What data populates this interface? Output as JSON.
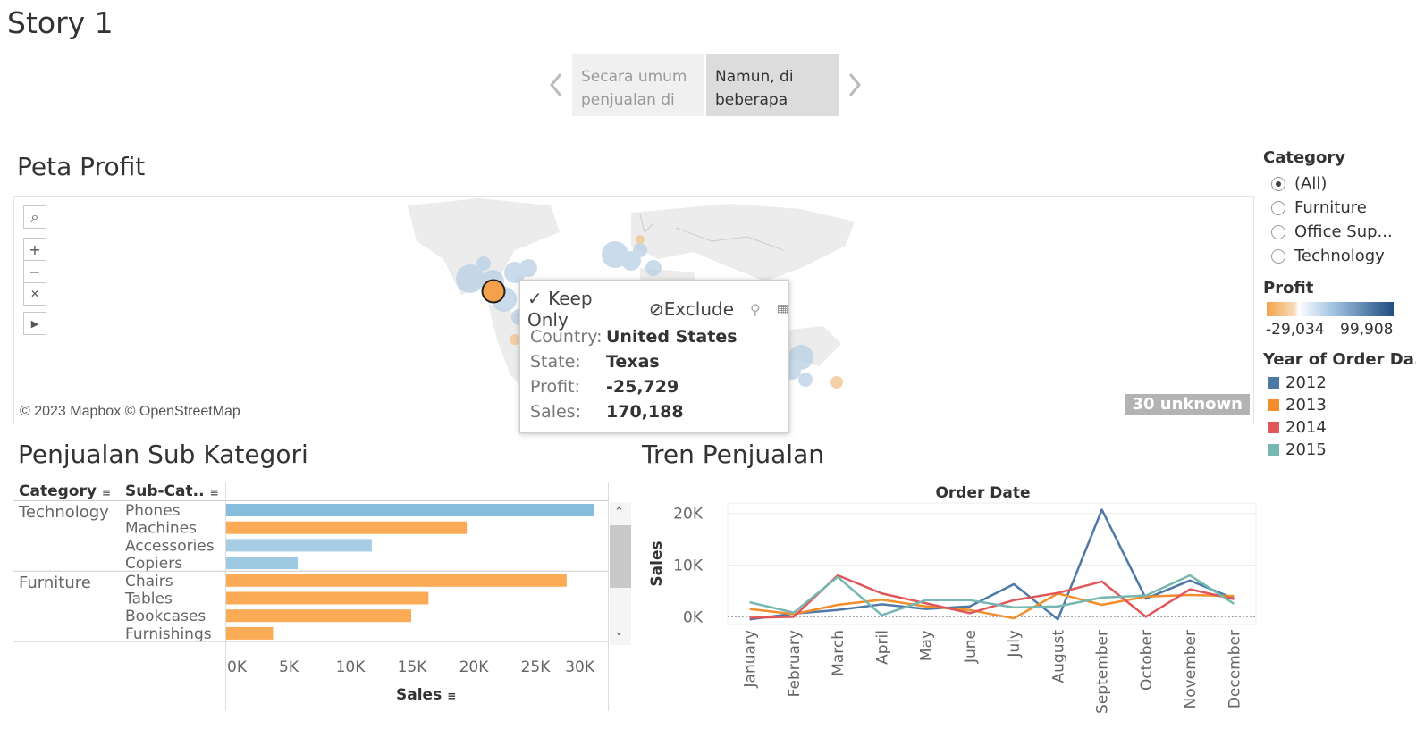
{
  "story": {
    "title": "Story 1",
    "points": [
      {
        "text": "Secara umum penjualan di"
      },
      {
        "text": "Namun, di beberapa"
      }
    ]
  },
  "map": {
    "title": "Peta Profit",
    "attribution": "© 2023 Mapbox © OpenStreetMap",
    "unknown_badge": "30 unknown",
    "controls": [
      "search-icon",
      "zoom-in-icon",
      "zoom-out-icon",
      "pin-icon",
      "expand-icon"
    ]
  },
  "tooltip": {
    "keep_only": "Keep Only",
    "exclude": "Exclude",
    "rows": [
      {
        "key": "Country:",
        "value": "United States"
      },
      {
        "key": "State:",
        "value": "Texas"
      },
      {
        "key": "Profit:",
        "value": "-25,729"
      },
      {
        "key": "Sales:",
        "value": "170,188"
      }
    ]
  },
  "filters": {
    "category_title": "Category",
    "category_options": [
      "(All)",
      "Furniture",
      "Office Sup...",
      "Technology"
    ],
    "selected": "(All)",
    "profit_title": "Profit",
    "profit_min": "-29,034",
    "profit_max": "99,908",
    "profit_colors": [
      "#f3a34a",
      "#ffffff",
      "#1f4e80"
    ],
    "year_title": "Year of Order Da..",
    "years": [
      {
        "label": "2012",
        "color": "#4e79a7"
      },
      {
        "label": "2013",
        "color": "#f28e2b"
      },
      {
        "label": "2014",
        "color": "#e15759"
      },
      {
        "label": "2015",
        "color": "#76b7b2"
      }
    ]
  },
  "sub_kategori": {
    "title": "Penjualan Sub Kategori",
    "col_category": "Category",
    "col_subcat": "Sub-Cat..",
    "axis_title": "Sales",
    "chart_data": {
      "type": "bar",
      "orientation": "horizontal",
      "xlabel": "Sales",
      "xlim": [
        0,
        30000
      ],
      "ticks": [
        "0K",
        "5K",
        "10K",
        "15K",
        "20K",
        "25K",
        "30K"
      ],
      "groups": [
        {
          "category": "Technology",
          "items": [
            {
              "name": "Phones",
              "value": 29800,
              "color": "#86bcdc"
            },
            {
              "name": "Machines",
              "value": 19500,
              "color": "#fbaa55"
            },
            {
              "name": "Accessories",
              "value": 11800,
              "color": "#a6cde3"
            },
            {
              "name": "Copiers",
              "value": 5800,
              "color": "#9ec9e2"
            }
          ]
        },
        {
          "category": "Furniture",
          "items": [
            {
              "name": "Chairs",
              "value": 27600,
              "color": "#fbaa55"
            },
            {
              "name": "Tables",
              "value": 16400,
              "color": "#fbaa55"
            },
            {
              "name": "Bookcases",
              "value": 15000,
              "color": "#fbaa55"
            },
            {
              "name": "Furnishings",
              "value": 3800,
              "color": "#fbaa55"
            }
          ]
        }
      ]
    }
  },
  "tren": {
    "title": "Tren Penjualan",
    "chart_data": {
      "type": "line",
      "title": "Order Date",
      "ylabel": "Sales",
      "ylim": [
        -1500,
        22000
      ],
      "yticks": [
        "20K",
        "10K",
        "0K"
      ],
      "categories": [
        "January",
        "February",
        "March",
        "April",
        "May",
        "June",
        "July",
        "August",
        "September",
        "October",
        "November",
        "December"
      ],
      "series": [
        {
          "name": "2012",
          "color": "#4e79a7",
          "values": [
            -500,
            600,
            1300,
            2400,
            1500,
            2000,
            6300,
            -500,
            20700,
            3500,
            7000,
            3500
          ]
        },
        {
          "name": "2013",
          "color": "#f28e2b",
          "values": [
            1500,
            500,
            2300,
            3300,
            2000,
            1300,
            -300,
            4500,
            2300,
            3900,
            4200,
            4000
          ]
        },
        {
          "name": "2014",
          "color": "#e15759",
          "values": [
            -200,
            0,
            8000,
            4500,
            2600,
            700,
            3200,
            4600,
            6800,
            0,
            5300,
            3400
          ]
        },
        {
          "name": "2015",
          "color": "#76b7b2",
          "values": [
            2800,
            800,
            7700,
            300,
            3200,
            3200,
            1800,
            2000,
            3700,
            4100,
            8000,
            2500
          ]
        }
      ]
    }
  }
}
